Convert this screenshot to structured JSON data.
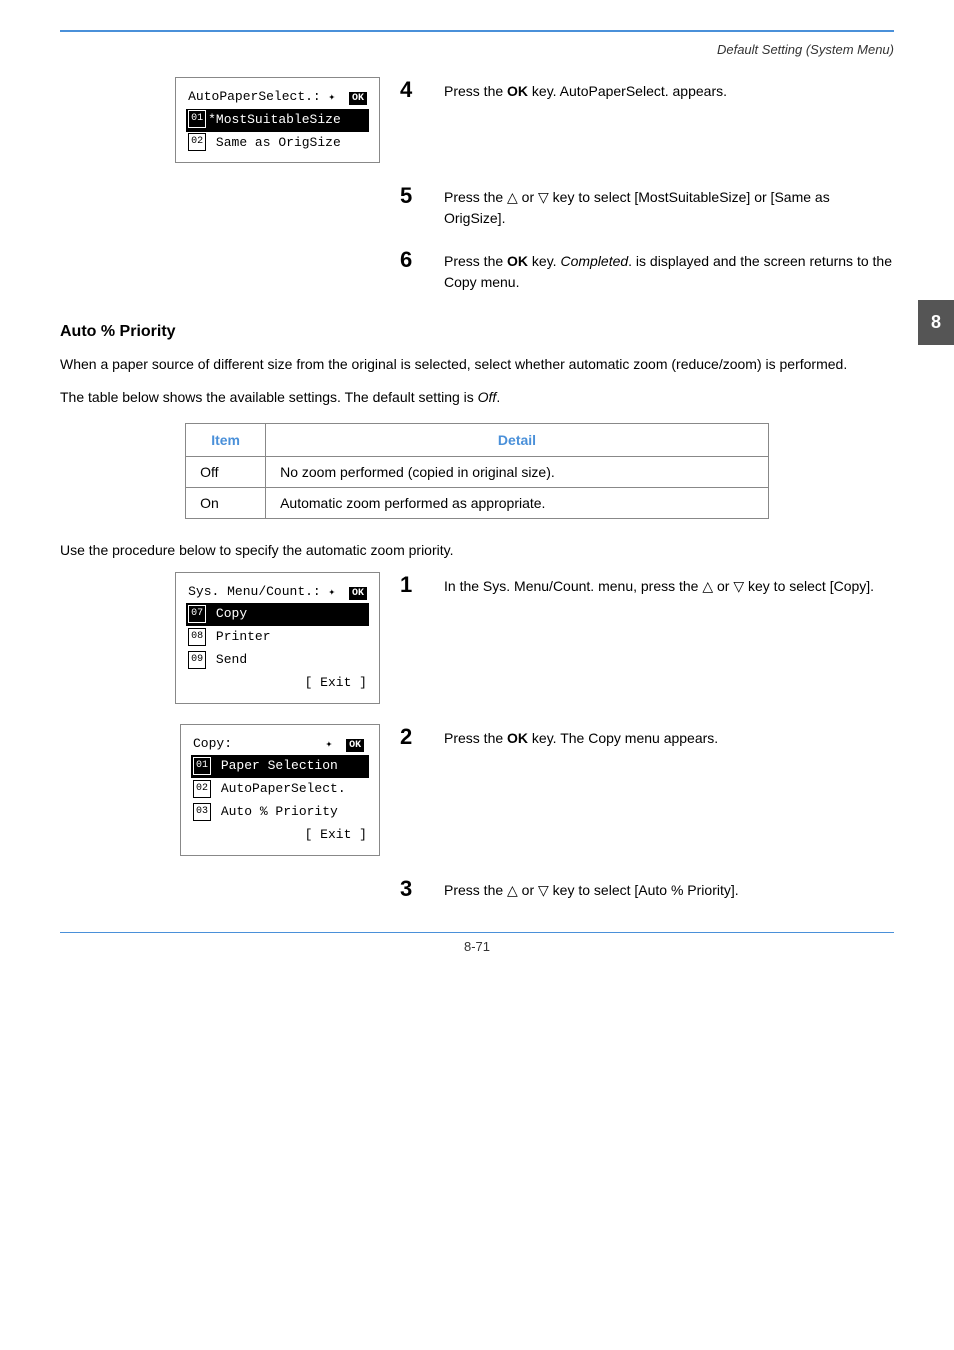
{
  "header": {
    "title": "Default Setting (System Menu)"
  },
  "chapter_number": "8",
  "page_number": "8-71",
  "section_auto_paper": {
    "step4": {
      "number": "4",
      "text": "Press the ",
      "bold": "OK",
      "text2": " key. AutoPaperSelect. appears."
    },
    "step5": {
      "number": "5",
      "text": "Press the △ or ▽ key to select [MostSuitableSize] or [Same as OrigSize]."
    },
    "step6": {
      "number": "6",
      "text": "Press the ",
      "bold": "OK",
      "text2": " key. ",
      "italic": "Completed",
      "text3": ". is displayed and the screen returns to the Copy menu."
    },
    "lcd": {
      "title": "AutoPaperSelect.:",
      "rows": [
        {
          "num": "01",
          "text": "*MostSuitableSize",
          "selected": true
        },
        {
          "num": "02",
          "text": " Same as OrigSize",
          "selected": false
        }
      ]
    }
  },
  "section_auto_priority": {
    "title": "Auto % Priority",
    "intro1": "When a paper source of different size from the original is selected, select whether automatic zoom (reduce/zoom) is performed.",
    "intro2": "The table below shows the available settings. The default setting is ",
    "intro2_italic": "Off",
    "intro2_end": ".",
    "table": {
      "col1": "Item",
      "col2": "Detail",
      "rows": [
        {
          "item": "Off",
          "detail": "No zoom performed (copied in original size)."
        },
        {
          "item": "On",
          "detail": "Automatic zoom performed as appropriate."
        }
      ]
    },
    "procedure_intro": "Use the procedure below to specify the automatic zoom priority.",
    "step1": {
      "number": "1",
      "text": "In the Sys. Menu/Count. menu, press the △ or ▽ key to select [Copy]."
    },
    "step2": {
      "number": "2",
      "text": "Press the ",
      "bold": "OK",
      "text2": " key. The Copy menu appears."
    },
    "step3": {
      "number": "3",
      "text": "Press the △ or ▽ key to select [Auto % Priority]."
    },
    "lcd1": {
      "title": "Sys. Menu/Count.:",
      "rows": [
        {
          "num": "07",
          "text": " Copy",
          "selected": true
        },
        {
          "num": "08",
          "text": " Printer",
          "selected": false
        },
        {
          "num": "09",
          "text": " Send",
          "selected": false
        }
      ],
      "footer": "[ Exit ]"
    },
    "lcd2": {
      "title": "Copy:",
      "rows": [
        {
          "num": "01",
          "text": " Paper Selection",
          "selected": true
        },
        {
          "num": "02",
          "text": " AutoPaperSelect.",
          "selected": false
        },
        {
          "num": "03",
          "text": " Auto % Priority",
          "selected": false
        }
      ],
      "footer": "[ Exit ]"
    }
  }
}
